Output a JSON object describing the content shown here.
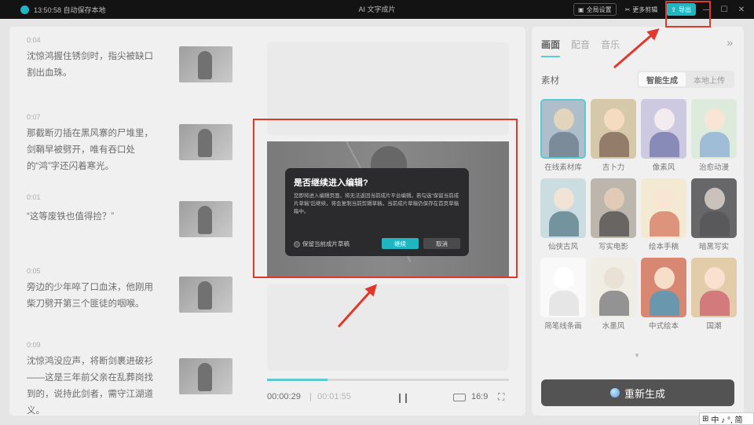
{
  "titlebar": {
    "autosave": "13:50:58 自动保存本地",
    "title": "AI 文字成片",
    "btn_fullscreen_settings": "全局设置",
    "btn_more_clips": "更多剪辑",
    "btn_export": "导出"
  },
  "script": {
    "segments": [
      {
        "time": "0:04",
        "text": "沈惊鸿握住锈剑时，指尖被缺口割出血珠。"
      },
      {
        "time": "0:07",
        "text": "那截断刃插在黑风寨的尸堆里，剑鞘早被劈开，唯有吞口处的“鸿”字还闪着寒光。"
      },
      {
        "time": "0:01",
        "text": "“这等废铁也值得捡？”"
      },
      {
        "time": "0:05",
        "text": "旁边的少年啐了口血沫，他刚用柴刀劈开第三个匪徒的咽喉。"
      },
      {
        "time": "0:09",
        "text": "沈惊鸿没应声，将断剑裹进破衫——这是三年前父亲在乱葬岗找到的，说持此剑者，需守江湖道义。"
      }
    ]
  },
  "player": {
    "current_time": "00:00:29",
    "separator": "|",
    "total_time": "00:01:55",
    "aspect_ratio": "16:9",
    "progress": 0.25
  },
  "side": {
    "tabs": [
      "画面",
      "配音",
      "音乐"
    ],
    "active_tab": "画面",
    "material_label": "素材",
    "source_options": [
      "智能生成",
      "本地上传"
    ],
    "active_source": "智能生成",
    "styles": [
      {
        "name": "在线素材库",
        "selected": true,
        "bg": "#8fa6b8",
        "skin": "#d9c4a4",
        "cloth": "#4a5f73"
      },
      {
        "name": "吉卜力",
        "selected": false,
        "bg": "#c7b48a",
        "skin": "#f2cfa8",
        "cloth": "#6b4a32"
      },
      {
        "name": "像素风",
        "selected": false,
        "bg": "#b9b5d6",
        "skin": "#f0e4ea",
        "cloth": "#5b5f9c"
      },
      {
        "name": "治愈动漫",
        "selected": false,
        "bg": "#cfe3cf",
        "skin": "#f5dcc6",
        "cloth": "#7aa4c8"
      },
      {
        "name": "仙侠古风",
        "selected": false,
        "bg": "#b9d0d6",
        "skin": "#eed8c8",
        "cloth": "#3d6a7a"
      },
      {
        "name": "写实电影",
        "selected": false,
        "bg": "#a39a8e",
        "skin": "#d6b89a",
        "cloth": "#2e2a28"
      },
      {
        "name": "绘本手稿",
        "selected": false,
        "bg": "#f0e2c4",
        "skin": "#f5dcc2",
        "cloth": "#d06a4a"
      },
      {
        "name": "暗黑写实",
        "selected": false,
        "bg": "#2d2d30",
        "skin": "#b6aaa4",
        "cloth": "#1a1a1c"
      },
      {
        "name": "简笔线条画",
        "selected": false,
        "bg": "#f7f7f7",
        "skin": "#ffffff",
        "cloth": "#dddddd"
      },
      {
        "name": "水墨风",
        "selected": false,
        "bg": "#ebe6dc",
        "skin": "#e2d6c6",
        "cloth": "#6a6a6a"
      },
      {
        "name": "中式绘本",
        "selected": false,
        "bg": "#c9593c",
        "skin": "#f3d2b4",
        "cloth": "#2f6f8f"
      },
      {
        "name": "国潮",
        "selected": false,
        "bg": "#d7b98a",
        "skin": "#f5d7bd",
        "cloth": "#c2474a"
      }
    ],
    "regenerate_label": "重新生成"
  },
  "modal": {
    "title": "是否继续进入编辑?",
    "body": "您即将进入编辑页面，将无法返回当前成片平台编辑。若勾选“保留当前成片草稿”后继续，将会复制当前剪辑草稿，当前成片草稿仍保存在首页草稿箱中。",
    "checkbox_label": "保留当前成片草稿",
    "confirm": "继续",
    "cancel": "取消"
  },
  "ime": {
    "text": "中 ♪ °, 简"
  },
  "colors": {
    "accent": "#1fb6c1",
    "annotation": "#e2382b"
  }
}
